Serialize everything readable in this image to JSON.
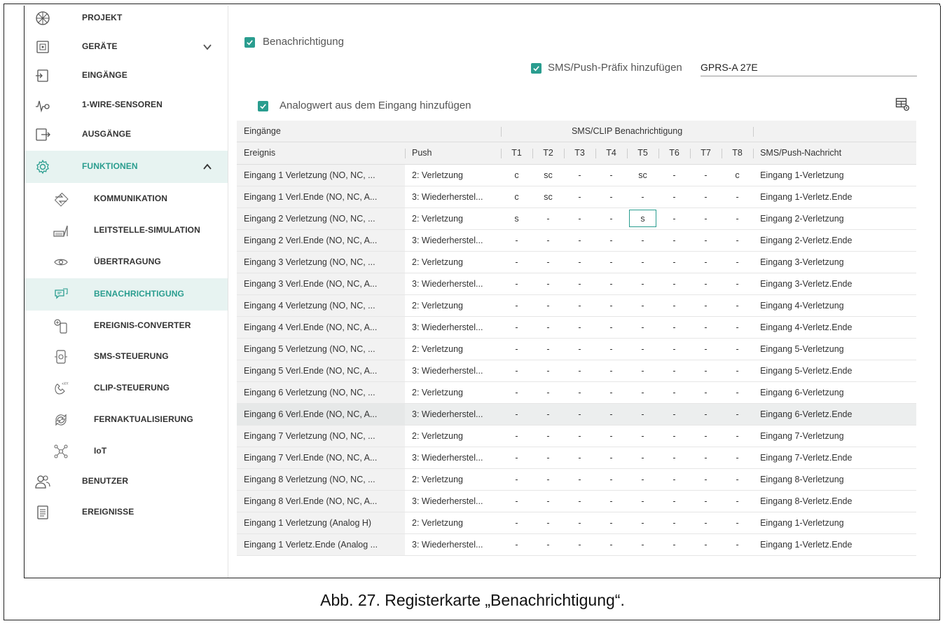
{
  "caption": "Abb. 27. Registerkarte „Benachrichtigung“.",
  "colors": {
    "accent": "#2a9d8f",
    "active_bg": "#e7f3f1"
  },
  "sidebar": {
    "items": [
      {
        "label": "PROJEKT",
        "icon": "project-icon",
        "level": 1
      },
      {
        "label": "GERÄTE",
        "icon": "device-icon",
        "level": 1,
        "chevron": "down"
      },
      {
        "label": "EINGÄNGE",
        "icon": "inputs-icon",
        "level": 1
      },
      {
        "label": "1-WIRE-SENSOREN",
        "icon": "sensor-icon",
        "level": 1
      },
      {
        "label": "AUSGÄNGE",
        "icon": "outputs-icon",
        "level": 1
      },
      {
        "label": "FUNKTIONEN",
        "icon": "gear-icon",
        "level": 1,
        "chevron": "up",
        "active": true
      },
      {
        "label": "KOMMUNIKATION",
        "icon": "communication-icon",
        "level": 2
      },
      {
        "label": "LEITSTELLE-SIMULATION",
        "icon": "monitoring-icon",
        "level": 2
      },
      {
        "label": "ÜBERTRAGUNG",
        "icon": "eye-icon",
        "level": 2
      },
      {
        "label": "BENACHRICHTIGUNG",
        "icon": "chat-icon",
        "level": 2,
        "selected": true
      },
      {
        "label": "EREIGNIS-CONVERTER",
        "icon": "converter-icon",
        "level": 2
      },
      {
        "label": "SMS-STEUERUNG",
        "icon": "sms-control-icon",
        "level": 2
      },
      {
        "label": "CLIP-STEUERUNG",
        "icon": "clip-icon",
        "level": 2
      },
      {
        "label": "FERNAKTUALISIERUNG",
        "icon": "update-icon",
        "level": 2
      },
      {
        "label": "IoT",
        "icon": "iot-icon",
        "level": 2
      },
      {
        "label": "BENUTZER",
        "icon": "users-icon",
        "level": 1
      },
      {
        "label": "EREIGNISSE",
        "icon": "events-icon",
        "level": 1
      }
    ]
  },
  "main": {
    "notify_label": "Benachrichtigung",
    "prefix_label": "SMS/Push-Präfix hinzufügen",
    "prefix_value": "GPRS-A 27E",
    "analog_label": "Analogwert aus dem Eingang hinzufügen"
  },
  "table": {
    "group_headers": {
      "inputs": "Eingänge",
      "sms": "SMS/CLIP Benachrichtigung"
    },
    "columns": [
      "Ereignis",
      "Push",
      "T1",
      "T2",
      "T3",
      "T4",
      "T5",
      "T6",
      "T7",
      "T8",
      "SMS/Push-Nachricht"
    ],
    "rows": [
      [
        "Eingang 1 Verletzung (NO, NC, ...",
        "2: Verletzung",
        "c",
        "sc",
        "-",
        "-",
        "sc",
        "-",
        "-",
        "c",
        "Eingang 1-Verletzung"
      ],
      [
        "Eingang 1 Verl.Ende (NO, NC, A...",
        "3: Wiederherstel...",
        "c",
        "sc",
        "-",
        "-",
        "-",
        "-",
        "-",
        "-",
        "Eingang 1-Verletz.Ende"
      ],
      [
        "Eingang 2 Verletzung (NO, NC, ...",
        "2: Verletzung",
        "s",
        "-",
        "-",
        "-",
        "s",
        "-",
        "-",
        "-",
        "Eingang 2-Verletzung"
      ],
      [
        "Eingang 2 Verl.Ende (NO, NC, A...",
        "3: Wiederherstel...",
        "-",
        "-",
        "-",
        "-",
        "-",
        "-",
        "-",
        "-",
        "Eingang 2-Verletz.Ende"
      ],
      [
        "Eingang 3 Verletzung (NO, NC, ...",
        "2: Verletzung",
        "-",
        "-",
        "-",
        "-",
        "-",
        "-",
        "-",
        "-",
        "Eingang 3-Verletzung"
      ],
      [
        "Eingang 3 Verl.Ende (NO, NC, A...",
        "3: Wiederherstel...",
        "-",
        "-",
        "-",
        "-",
        "-",
        "-",
        "-",
        "-",
        "Eingang 3-Verletz.Ende"
      ],
      [
        "Eingang 4 Verletzung (NO, NC, ...",
        "2: Verletzung",
        "-",
        "-",
        "-",
        "-",
        "-",
        "-",
        "-",
        "-",
        "Eingang 4-Verletzung"
      ],
      [
        "Eingang 4 Verl.Ende (NO, NC, A...",
        "3: Wiederherstel...",
        "-",
        "-",
        "-",
        "-",
        "-",
        "-",
        "-",
        "-",
        "Eingang 4-Verletz.Ende"
      ],
      [
        "Eingang 5 Verletzung (NO, NC, ...",
        "2: Verletzung",
        "-",
        "-",
        "-",
        "-",
        "-",
        "-",
        "-",
        "-",
        "Eingang 5-Verletzung"
      ],
      [
        "Eingang 5 Verl.Ende (NO, NC, A...",
        "3: Wiederherstel...",
        "-",
        "-",
        "-",
        "-",
        "-",
        "-",
        "-",
        "-",
        "Eingang 5-Verletz.Ende"
      ],
      [
        "Eingang 6 Verletzung (NO, NC, ...",
        "2: Verletzung",
        "-",
        "-",
        "-",
        "-",
        "-",
        "-",
        "-",
        "-",
        "Eingang 6-Verletzung"
      ],
      [
        "Eingang 6 Verl.Ende (NO, NC, A...",
        "3: Wiederherstel...",
        "-",
        "-",
        "-",
        "-",
        "-",
        "-",
        "-",
        "-",
        "Eingang 6-Verletz.Ende"
      ],
      [
        "Eingang 7 Verletzung (NO, NC, ...",
        "2: Verletzung",
        "-",
        "-",
        "-",
        "-",
        "-",
        "-",
        "-",
        "-",
        "Eingang 7-Verletzung"
      ],
      [
        "Eingang 7 Verl.Ende (NO, NC, A...",
        "3: Wiederherstel...",
        "-",
        "-",
        "-",
        "-",
        "-",
        "-",
        "-",
        "-",
        "Eingang 7-Verletz.Ende"
      ],
      [
        "Eingang 8 Verletzung (NO, NC, ...",
        "2: Verletzung",
        "-",
        "-",
        "-",
        "-",
        "-",
        "-",
        "-",
        "-",
        "Eingang 8-Verletzung"
      ],
      [
        "Eingang 8 Verl.Ende (NO, NC, A...",
        "3: Wiederherstel...",
        "-",
        "-",
        "-",
        "-",
        "-",
        "-",
        "-",
        "-",
        "Eingang 8-Verletz.Ende"
      ],
      [
        "Eingang 1 Verletzung (Analog H)",
        "2: Verletzung",
        "-",
        "-",
        "-",
        "-",
        "-",
        "-",
        "-",
        "-",
        "Eingang 1-Verletzung"
      ],
      [
        "Eingang 1 Verletz.Ende (Analog ...",
        "3: Wiederherstel...",
        "-",
        "-",
        "-",
        "-",
        "-",
        "-",
        "-",
        "-",
        "Eingang 1-Verletz.Ende"
      ]
    ],
    "selected_cell": {
      "row": 2,
      "col": 6
    },
    "highlighted_row": 11
  }
}
